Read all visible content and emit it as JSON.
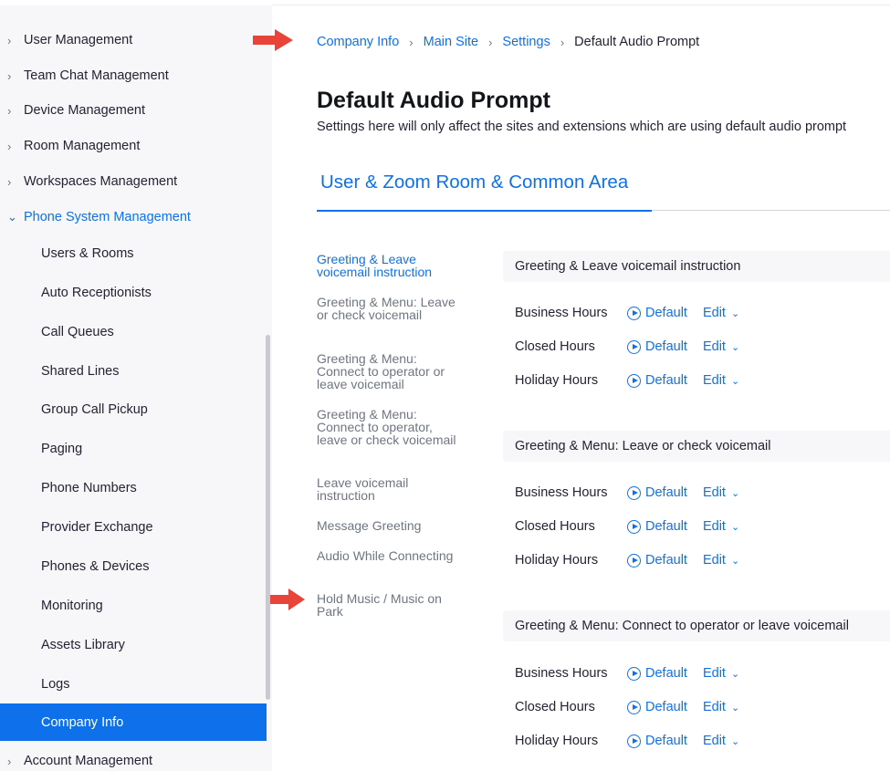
{
  "sidebar": {
    "top_items": [
      {
        "label": "User Management"
      },
      {
        "label": "Team Chat Management"
      },
      {
        "label": "Device Management"
      },
      {
        "label": "Room Management"
      },
      {
        "label": "Workspaces Management"
      },
      {
        "label": "Phone System Management"
      }
    ],
    "sub_items": [
      {
        "label": "Users & Rooms"
      },
      {
        "label": "Auto Receptionists"
      },
      {
        "label": "Call Queues"
      },
      {
        "label": "Shared Lines"
      },
      {
        "label": "Group Call Pickup"
      },
      {
        "label": "Paging"
      },
      {
        "label": "Phone Numbers"
      },
      {
        "label": "Provider Exchange"
      },
      {
        "label": "Phones & Devices"
      },
      {
        "label": "Monitoring"
      },
      {
        "label": "Assets Library"
      },
      {
        "label": "Logs"
      },
      {
        "label": "Company Info"
      }
    ],
    "bottom_item": {
      "label": "Account Management"
    }
  },
  "breadcrumb": {
    "items": [
      "Company Info",
      "Main Site",
      "Settings"
    ],
    "current": "Default Audio Prompt"
  },
  "page": {
    "title": "Default Audio Prompt",
    "description": "Settings here will only affect the sites and extensions which are using default audio prompt"
  },
  "tab": {
    "label": "User & Zoom Room & Common Area"
  },
  "section_links": [
    "Greeting & Leave voicemail instruction",
    "Greeting & Menu: Leave or check voicemail",
    "Greeting & Menu: Connect to operator or leave voicemail",
    "Greeting & Menu: Connect to operator, leave or check voicemail",
    "Leave voicemail instruction",
    "Message Greeting",
    "Audio While Connecting",
    "Hold Music / Music on Park"
  ],
  "sections": [
    {
      "title": "Greeting & Leave voicemail instruction",
      "rows": [
        {
          "label": "Business Hours",
          "value": "Default",
          "action": "Edit"
        },
        {
          "label": "Closed Hours",
          "value": "Default",
          "action": "Edit"
        },
        {
          "label": "Holiday Hours",
          "value": "Default",
          "action": "Edit"
        }
      ]
    },
    {
      "title": "Greeting & Menu: Leave or check voicemail",
      "rows": [
        {
          "label": "Business Hours",
          "value": "Default",
          "action": "Edit"
        },
        {
          "label": "Closed Hours",
          "value": "Default",
          "action": "Edit"
        },
        {
          "label": "Holiday Hours",
          "value": "Default",
          "action": "Edit"
        }
      ]
    },
    {
      "title": "Greeting & Menu: Connect to operator or leave voicemail",
      "rows": [
        {
          "label": "Business Hours",
          "value": "Default",
          "action": "Edit"
        },
        {
          "label": "Closed Hours",
          "value": "Default",
          "action": "Edit"
        },
        {
          "label": "Holiday Hours",
          "value": "Default",
          "action": "Edit"
        }
      ]
    }
  ],
  "colors": {
    "accent": "#0e71eb",
    "sidebar_bg": "#f7f7fa",
    "annotation": "#e8443a"
  },
  "icons": {
    "nav_chevron": "chevron-right-icon",
    "expanded_chevron": "chevron-down-icon",
    "play": "play-circle-icon",
    "dropdown": "chevron-down-icon"
  }
}
